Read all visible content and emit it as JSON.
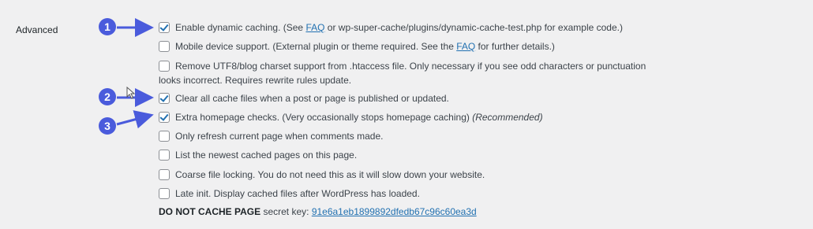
{
  "section": {
    "label": "Advanced"
  },
  "options": [
    {
      "checked": true,
      "prefix": "Enable dynamic caching. (See ",
      "link": "FAQ",
      "suffix": " or wp-super-cache/plugins/dynamic-cache-test.php for example code.)"
    },
    {
      "checked": false,
      "prefix": "Mobile device support. (External plugin or theme required. See the ",
      "link": "FAQ",
      "suffix": " for further details.)"
    },
    {
      "checked": false,
      "text": "Remove UTF8/blog charset support from .htaccess file. Only necessary if you see odd characters or punctuation looks incorrect. Requires rewrite rules update."
    },
    {
      "checked": true,
      "text": "Clear all cache files when a post or page is published or updated."
    },
    {
      "checked": true,
      "text": "Extra homepage checks. (Very occasionally stops homepage caching) ",
      "emphasis": "(Recommended)"
    },
    {
      "checked": false,
      "text": "Only refresh current page when comments made."
    },
    {
      "checked": false,
      "text": "List the newest cached pages on this page."
    },
    {
      "checked": false,
      "text": "Coarse file locking. You do not need this as it will slow down your website."
    },
    {
      "checked": false,
      "text": "Late init. Display cached files after WordPress has loaded."
    }
  ],
  "secret_key": {
    "label": "DO NOT CACHE PAGE",
    "middle": " secret key: ",
    "value": "91e6a1eb1899892dfedb67c96c60ea3d"
  },
  "annotations": {
    "markers": [
      "1",
      "2",
      "3"
    ],
    "color": "#4a5bdc"
  },
  "colors": {
    "background": "#f0f0f1",
    "link": "#2271b1",
    "text": "#3c434a",
    "checkbox_border": "#8c8f94"
  }
}
